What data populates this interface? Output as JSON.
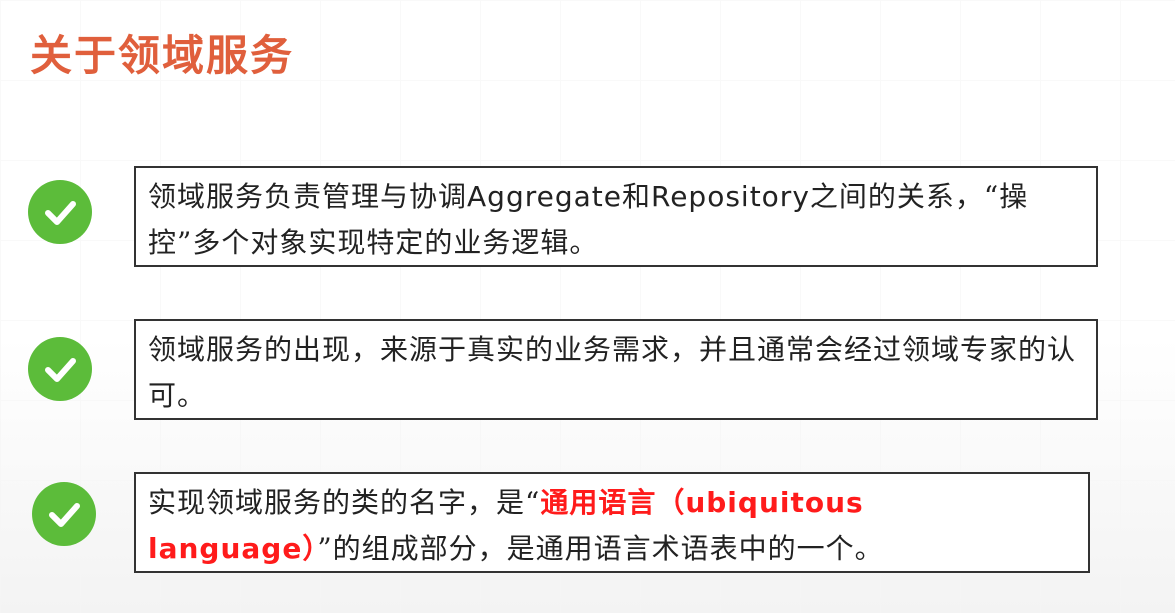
{
  "slide": {
    "title": "关于领域服务",
    "items": [
      {
        "text_part1": "领域服务负责管理与协调",
        "text_latin1": "Aggregate",
        "text_part2": "和",
        "text_latin2": "Repository",
        "text_part3": "之间的关系，“操控”多个对象实现特定的业务逻辑。"
      },
      {
        "text": "领域服务的出现，来源于真实的业务需求，并且通常会经过领域专家的认可。"
      },
      {
        "text_before": "实现领域服务的类的名字，是“",
        "text_highlight": "通用语言（ubiquitous language）",
        "text_after": "”的组成部分，是通用语言术语表中的一个。"
      }
    ]
  },
  "colors": {
    "title": "#e05f3c",
    "check": "#5cbc3a",
    "highlight": "#ff1b1b",
    "box_border": "#333333"
  },
  "icons": [
    "check-icon",
    "check-icon",
    "check-icon"
  ]
}
